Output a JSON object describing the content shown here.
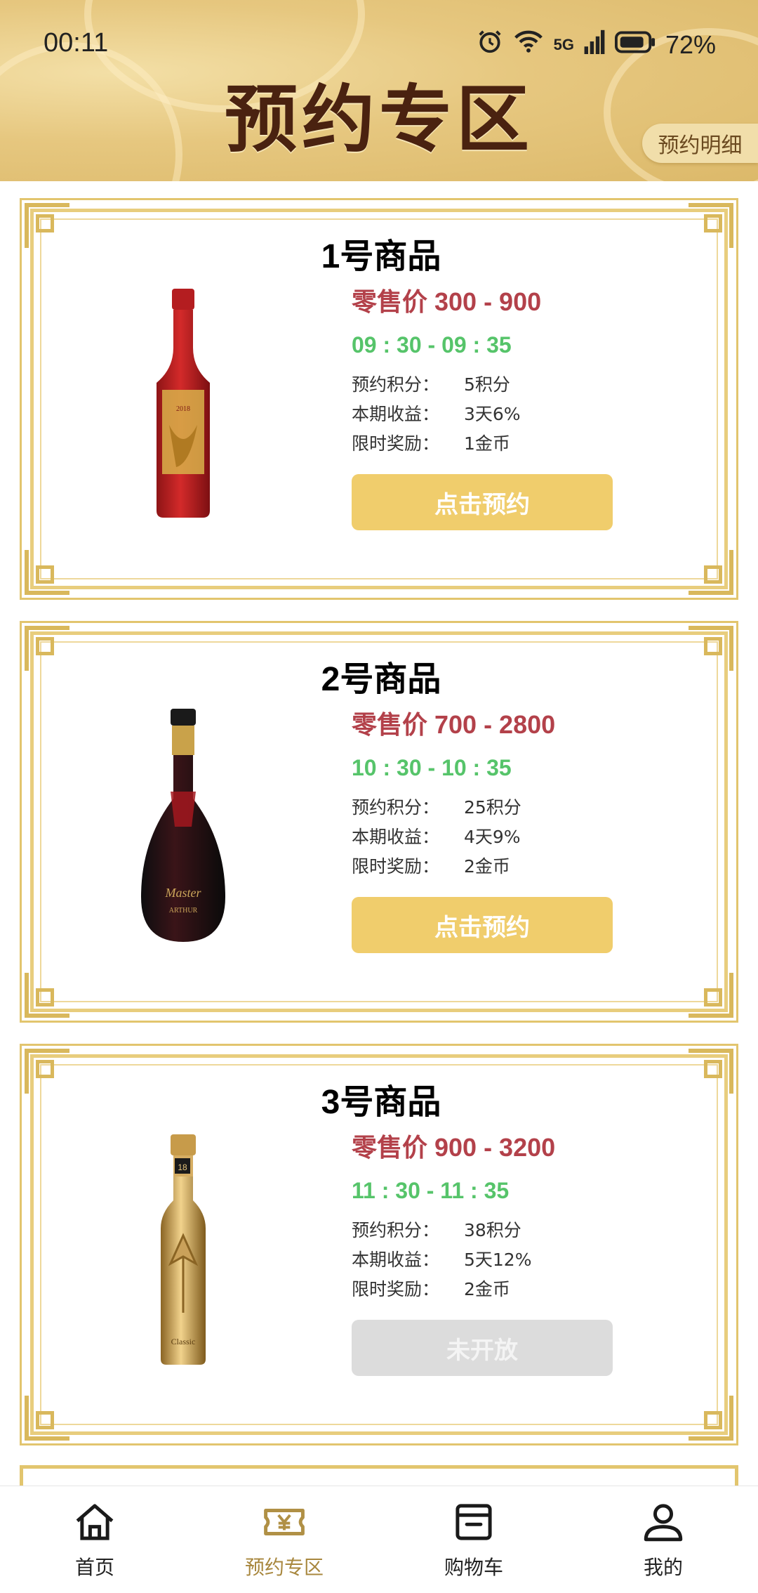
{
  "status_bar": {
    "time": "00:11",
    "battery": "72%",
    "network": "5G"
  },
  "header": {
    "title": "预约专区",
    "detail_button": "预约明细"
  },
  "colors": {
    "accent_gold": "#f0cd6c",
    "price_red": "#b3414a",
    "time_green": "#56c46a",
    "disabled_gray": "#dcdcdc"
  },
  "products": [
    {
      "name": "1号商品",
      "price": "零售价 300 - 900",
      "time": "09 : 30 - 09 : 35",
      "points_label": "预约积分：",
      "points": "5积分",
      "income_label": "本期收益：",
      "income": "3天6%",
      "reward_label": "限时奖励：",
      "reward": "1金币",
      "button": "点击预约",
      "bottle": "red-wine-bottle"
    },
    {
      "name": "2号商品",
      "price": "零售价 700 - 2800",
      "time": "10 : 30 - 10 : 35",
      "points_label": "预约积分：",
      "points": "25积分",
      "income_label": "本期收益：",
      "income": "4天9%",
      "reward_label": "限时奖励：",
      "reward": "2金币",
      "button": "点击预约",
      "bottle": "black-wine-bottle"
    },
    {
      "name": "3号商品",
      "price": "零售价 900 - 3200",
      "time": "11 : 30 - 11 : 35",
      "points_label": "预约积分：",
      "points": "38积分",
      "income_label": "本期收益：",
      "income": "5天12%",
      "reward_label": "限时奖励：",
      "reward": "2金币",
      "button": "未开放",
      "bottle": "gold-wine-bottle"
    }
  ],
  "tabbar": [
    {
      "label": "首页",
      "icon": "home-icon"
    },
    {
      "label": "预约专区",
      "icon": "ticket-icon",
      "active": true
    },
    {
      "label": "购物车",
      "icon": "shop-icon"
    },
    {
      "label": "我的",
      "icon": "user-icon"
    }
  ]
}
